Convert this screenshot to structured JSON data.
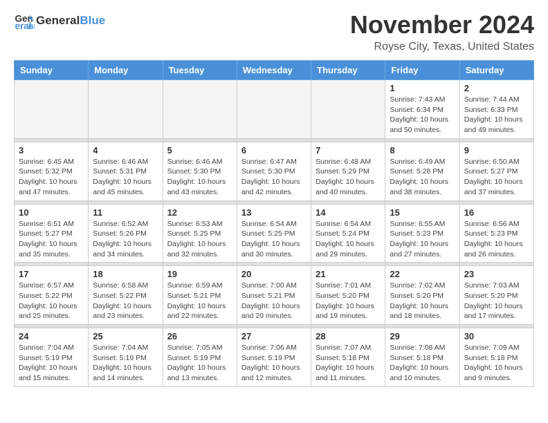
{
  "header": {
    "logo_line1": "General",
    "logo_line2": "Blue",
    "month_title": "November 2024",
    "location": "Royse City, Texas, United States"
  },
  "calendar": {
    "days_of_week": [
      "Sunday",
      "Monday",
      "Tuesday",
      "Wednesday",
      "Thursday",
      "Friday",
      "Saturday"
    ],
    "weeks": [
      [
        {
          "day": "",
          "info": ""
        },
        {
          "day": "",
          "info": ""
        },
        {
          "day": "",
          "info": ""
        },
        {
          "day": "",
          "info": ""
        },
        {
          "day": "",
          "info": ""
        },
        {
          "day": "1",
          "info": "Sunrise: 7:43 AM\nSunset: 6:34 PM\nDaylight: 10 hours and 50 minutes."
        },
        {
          "day": "2",
          "info": "Sunrise: 7:44 AM\nSunset: 6:33 PM\nDaylight: 10 hours and 49 minutes."
        }
      ],
      [
        {
          "day": "3",
          "info": "Sunrise: 6:45 AM\nSunset: 5:32 PM\nDaylight: 10 hours and 47 minutes."
        },
        {
          "day": "4",
          "info": "Sunrise: 6:46 AM\nSunset: 5:31 PM\nDaylight: 10 hours and 45 minutes."
        },
        {
          "day": "5",
          "info": "Sunrise: 6:46 AM\nSunset: 5:30 PM\nDaylight: 10 hours and 43 minutes."
        },
        {
          "day": "6",
          "info": "Sunrise: 6:47 AM\nSunset: 5:30 PM\nDaylight: 10 hours and 42 minutes."
        },
        {
          "day": "7",
          "info": "Sunrise: 6:48 AM\nSunset: 5:29 PM\nDaylight: 10 hours and 40 minutes."
        },
        {
          "day": "8",
          "info": "Sunrise: 6:49 AM\nSunset: 5:28 PM\nDaylight: 10 hours and 38 minutes."
        },
        {
          "day": "9",
          "info": "Sunrise: 6:50 AM\nSunset: 5:27 PM\nDaylight: 10 hours and 37 minutes."
        }
      ],
      [
        {
          "day": "10",
          "info": "Sunrise: 6:51 AM\nSunset: 5:27 PM\nDaylight: 10 hours and 35 minutes."
        },
        {
          "day": "11",
          "info": "Sunrise: 6:52 AM\nSunset: 5:26 PM\nDaylight: 10 hours and 34 minutes."
        },
        {
          "day": "12",
          "info": "Sunrise: 6:53 AM\nSunset: 5:25 PM\nDaylight: 10 hours and 32 minutes."
        },
        {
          "day": "13",
          "info": "Sunrise: 6:54 AM\nSunset: 5:25 PM\nDaylight: 10 hours and 30 minutes."
        },
        {
          "day": "14",
          "info": "Sunrise: 6:54 AM\nSunset: 5:24 PM\nDaylight: 10 hours and 29 minutes."
        },
        {
          "day": "15",
          "info": "Sunrise: 6:55 AM\nSunset: 5:23 PM\nDaylight: 10 hours and 27 minutes."
        },
        {
          "day": "16",
          "info": "Sunrise: 6:56 AM\nSunset: 5:23 PM\nDaylight: 10 hours and 26 minutes."
        }
      ],
      [
        {
          "day": "17",
          "info": "Sunrise: 6:57 AM\nSunset: 5:22 PM\nDaylight: 10 hours and 25 minutes."
        },
        {
          "day": "18",
          "info": "Sunrise: 6:58 AM\nSunset: 5:22 PM\nDaylight: 10 hours and 23 minutes."
        },
        {
          "day": "19",
          "info": "Sunrise: 6:59 AM\nSunset: 5:21 PM\nDaylight: 10 hours and 22 minutes."
        },
        {
          "day": "20",
          "info": "Sunrise: 7:00 AM\nSunset: 5:21 PM\nDaylight: 10 hours and 20 minutes."
        },
        {
          "day": "21",
          "info": "Sunrise: 7:01 AM\nSunset: 5:20 PM\nDaylight: 10 hours and 19 minutes."
        },
        {
          "day": "22",
          "info": "Sunrise: 7:02 AM\nSunset: 5:20 PM\nDaylight: 10 hours and 18 minutes."
        },
        {
          "day": "23",
          "info": "Sunrise: 7:03 AM\nSunset: 5:20 PM\nDaylight: 10 hours and 17 minutes."
        }
      ],
      [
        {
          "day": "24",
          "info": "Sunrise: 7:04 AM\nSunset: 5:19 PM\nDaylight: 10 hours and 15 minutes."
        },
        {
          "day": "25",
          "info": "Sunrise: 7:04 AM\nSunset: 5:19 PM\nDaylight: 10 hours and 14 minutes."
        },
        {
          "day": "26",
          "info": "Sunrise: 7:05 AM\nSunset: 5:19 PM\nDaylight: 10 hours and 13 minutes."
        },
        {
          "day": "27",
          "info": "Sunrise: 7:06 AM\nSunset: 5:19 PM\nDaylight: 10 hours and 12 minutes."
        },
        {
          "day": "28",
          "info": "Sunrise: 7:07 AM\nSunset: 5:18 PM\nDaylight: 10 hours and 11 minutes."
        },
        {
          "day": "29",
          "info": "Sunrise: 7:08 AM\nSunset: 5:18 PM\nDaylight: 10 hours and 10 minutes."
        },
        {
          "day": "30",
          "info": "Sunrise: 7:09 AM\nSunset: 5:18 PM\nDaylight: 10 hours and 9 minutes."
        }
      ]
    ]
  }
}
